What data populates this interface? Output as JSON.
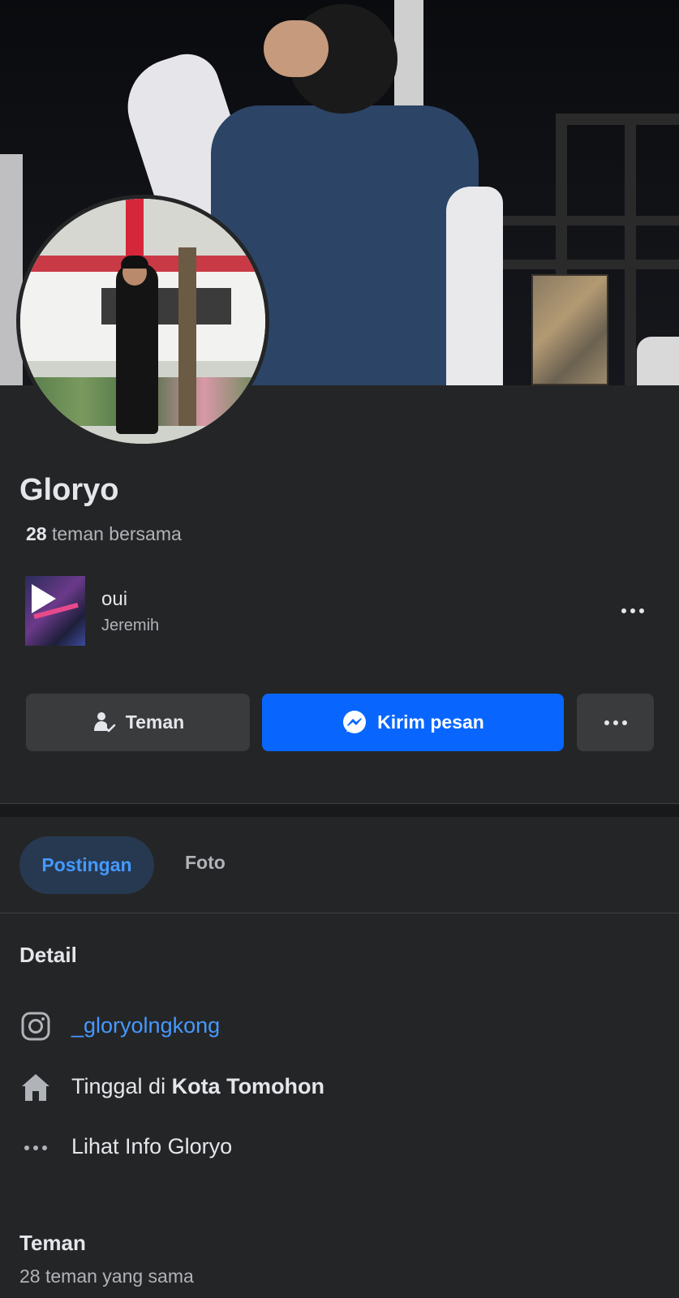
{
  "profile": {
    "name": "Gloryo",
    "mutual_count": "28",
    "mutual_label": " teman bersama"
  },
  "music": {
    "title": "oui",
    "artist": "Jeremih",
    "icon": "play-icon"
  },
  "actions": {
    "friend_label": "Teman",
    "friend_icon": "friend-check-icon",
    "message_label": "Kirim pesan",
    "message_icon": "messenger-icon",
    "more_icon": "more-icon"
  },
  "tabs": [
    {
      "label": "Postingan",
      "active": true
    },
    {
      "label": "Foto",
      "active": false
    }
  ],
  "details": {
    "title": "Detail",
    "instagram": "_gloryolngkong",
    "lives_prefix": "Tinggal di ",
    "lives_city": "Kota Tomohon",
    "see_info": "Lihat Info Gloryo"
  },
  "friends": {
    "title": "Teman",
    "subtitle": "28 teman yang sama"
  },
  "colors": {
    "background": "#242526",
    "primary_button": "#0866ff",
    "link": "#4599ff",
    "secondary_button": "#3a3b3c",
    "active_tab_bg": "#263951"
  }
}
